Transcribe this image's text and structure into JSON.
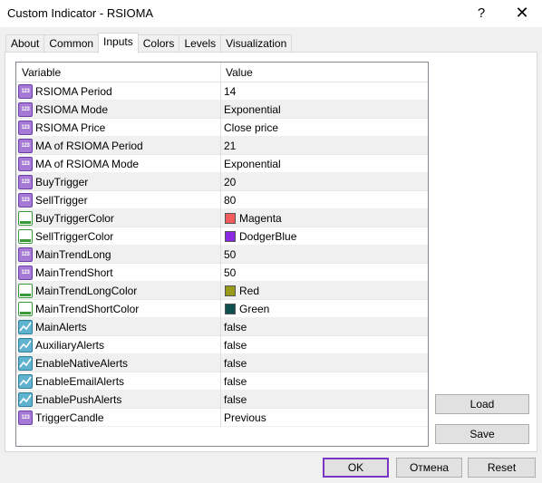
{
  "window": {
    "title": "Custom Indicator - RSIOMA",
    "help": "?",
    "close": "✕"
  },
  "tabs": [
    "About",
    "Common",
    "Inputs",
    "Colors",
    "Levels",
    "Visualization"
  ],
  "active_tab": "Inputs",
  "grid": {
    "columns": [
      "Variable",
      "Value"
    ],
    "rows": [
      {
        "icon": "int-icon",
        "name": "RSIOMA Period",
        "value": "14"
      },
      {
        "icon": "enum-icon",
        "name": "RSIOMA Mode",
        "value": "Exponential"
      },
      {
        "icon": "enum-icon",
        "name": "RSIOMA Price",
        "value": "Close price"
      },
      {
        "icon": "int-icon",
        "name": "MA of RSIOMA Period",
        "value": "21"
      },
      {
        "icon": "enum-icon",
        "name": "MA of RSIOMA Mode",
        "value": "Exponential"
      },
      {
        "icon": "int-icon",
        "name": "BuyTrigger",
        "value": "20"
      },
      {
        "icon": "int-icon",
        "name": "SellTrigger",
        "value": "80"
      },
      {
        "icon": "color-icon",
        "name": "BuyTriggerColor",
        "value": "Magenta",
        "swatch": "#f25c5c"
      },
      {
        "icon": "color-icon",
        "name": "SellTriggerColor",
        "value": "DodgerBlue",
        "swatch": "#8a2be2"
      },
      {
        "icon": "int-icon",
        "name": "MainTrendLong",
        "value": "50"
      },
      {
        "icon": "int-icon",
        "name": "MainTrendShort",
        "value": "50"
      },
      {
        "icon": "color-icon",
        "name": "MainTrendLongColor",
        "value": "Red",
        "swatch": "#9a9a1a"
      },
      {
        "icon": "color-icon",
        "name": "MainTrendShortColor",
        "value": "Green",
        "swatch": "#0f4f4f"
      },
      {
        "icon": "bool-icon",
        "name": "MainAlerts",
        "value": "false"
      },
      {
        "icon": "bool-icon",
        "name": "AuxiliaryAlerts",
        "value": "false"
      },
      {
        "icon": "bool-icon",
        "name": "EnableNativeAlerts",
        "value": "false"
      },
      {
        "icon": "bool-icon",
        "name": "EnableEmailAlerts",
        "value": "false"
      },
      {
        "icon": "bool-icon",
        "name": "EnablePushAlerts",
        "value": "false"
      },
      {
        "icon": "enum-icon",
        "name": "TriggerCandle",
        "value": "Previous"
      }
    ]
  },
  "icon_text": {
    "int": "123",
    "enum": "123"
  },
  "buttons": {
    "load": "Load",
    "save": "Save",
    "ok": "OK",
    "cancel": "Отмена",
    "reset": "Reset"
  },
  "colors": {
    "accent": "#7a35c4",
    "alt_row": "#f0f0f0",
    "border": "#828790"
  }
}
